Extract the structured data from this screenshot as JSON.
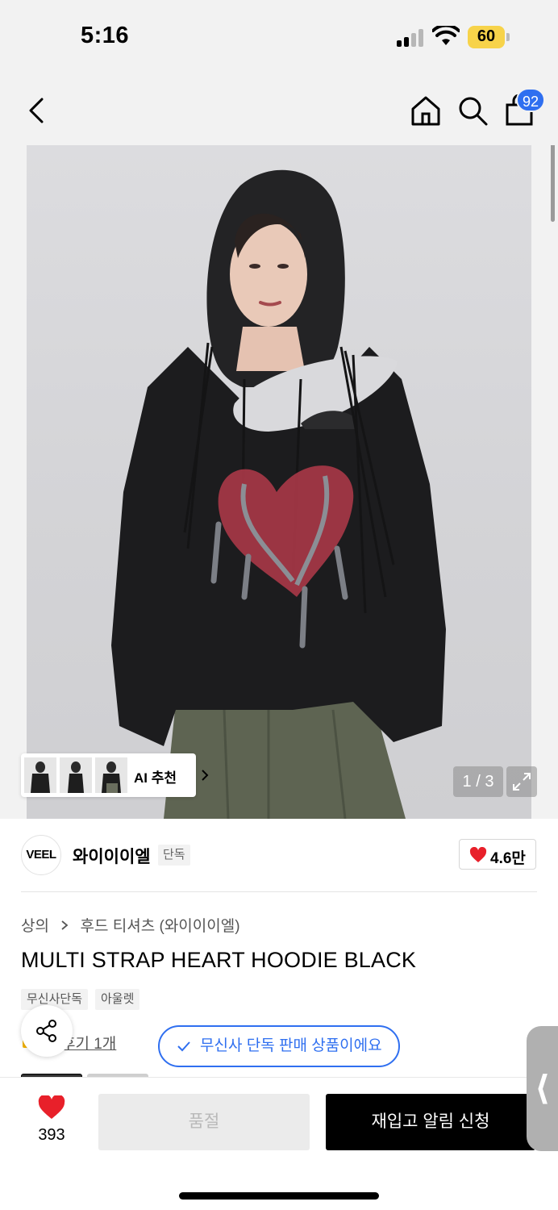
{
  "status_bar": {
    "time": "5:16",
    "battery": "60"
  },
  "nav": {
    "cart_count": "92"
  },
  "gallery": {
    "ai_label": "AI 추천",
    "counter": "1 / 3"
  },
  "brand": {
    "logo_text": "VEEL",
    "name": "와이이이엘",
    "badge": "단독",
    "likes": "4.6만"
  },
  "breadcrumb": {
    "category": "상의",
    "subcategory": "후드 티셔츠 (와이이이엘)"
  },
  "product": {
    "title": "MULTI STRAP HEART HOODIE BLACK",
    "tags": [
      "무신사단독",
      "아울렛"
    ],
    "review_link": "후기 1개",
    "exclusive_notice": "무신사 단독 판매 상품이에요"
  },
  "bottom_bar": {
    "wish_count": "393",
    "soldout_label": "품절",
    "restock_label": "재입고 알림 신청"
  },
  "edge_handle": "⟨",
  "colors": {
    "accent_blue": "#2f6ff0",
    "heart_red": "#e8202a",
    "battery_yellow": "#f7d34a"
  }
}
